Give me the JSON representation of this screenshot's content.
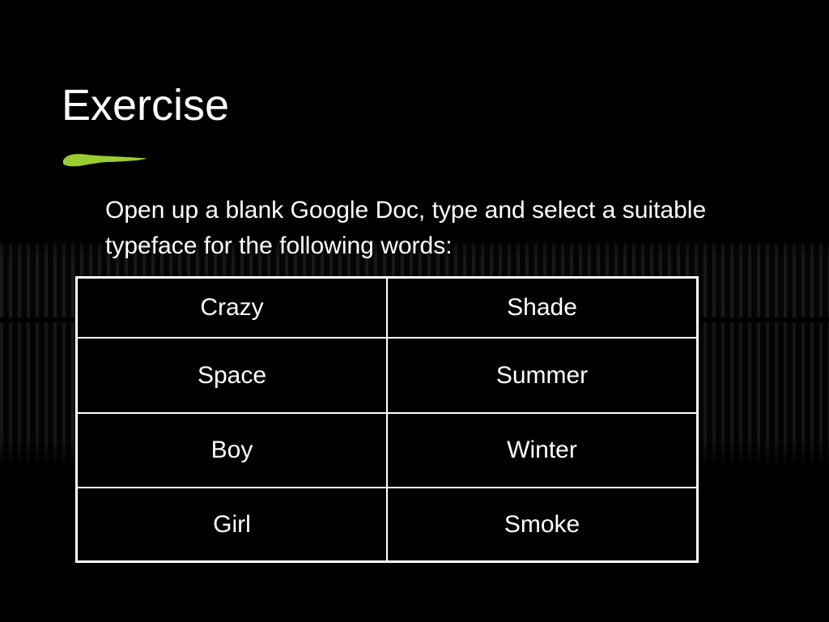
{
  "slide": {
    "title": "Exercise",
    "accent_color": "#9acd32",
    "body": "Open up a blank Google Doc, type and select a suitable typeface for the following words:",
    "table": {
      "rows": [
        [
          "Crazy",
          "Shade"
        ],
        [
          "Space",
          "Summer"
        ],
        [
          "Boy",
          "Winter"
        ],
        [
          "Girl",
          "Smoke"
        ]
      ]
    }
  },
  "icons": {
    "title_underline": "green-brush-stroke-icon"
  }
}
